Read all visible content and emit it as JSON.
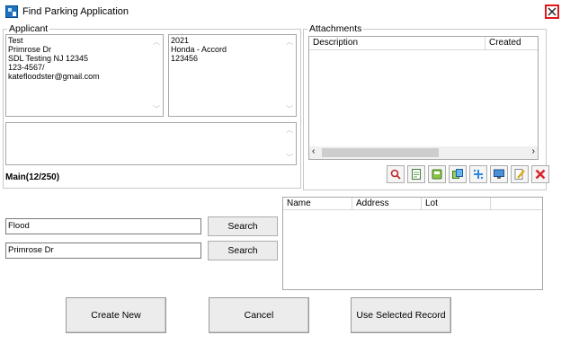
{
  "window": {
    "title": "Find Parking Application"
  },
  "applicant": {
    "legend": "Applicant",
    "info": [
      "Test",
      "Primrose Dr",
      "SDL Testing NJ 12345",
      "123-4567/",
      "katefloodster@gmail.com"
    ],
    "vehicle": [
      "2021",
      "Honda - Accord",
      "123456"
    ],
    "main_label": "Main(12/250)"
  },
  "attachments": {
    "legend": "Attachments",
    "columns": [
      "Description",
      "Created"
    ]
  },
  "search": {
    "last_name_value": "Flood",
    "street_value": "Primrose Dr",
    "search_label": "Search"
  },
  "results": {
    "columns": [
      "Name",
      "Address",
      "Lot"
    ]
  },
  "footer": {
    "create_new": "Create New",
    "cancel": "Cancel",
    "use_selected": "Use Selected Record"
  },
  "icons": {
    "close": "close-icon",
    "toolbar": [
      "magnify-icon",
      "page-icon",
      "scan-icon",
      "copy-icon",
      "add-icon",
      "monitor-icon",
      "edit-icon",
      "delete-icon"
    ]
  },
  "colors": {
    "close": "#e0191b",
    "delete": "#d9262b"
  }
}
